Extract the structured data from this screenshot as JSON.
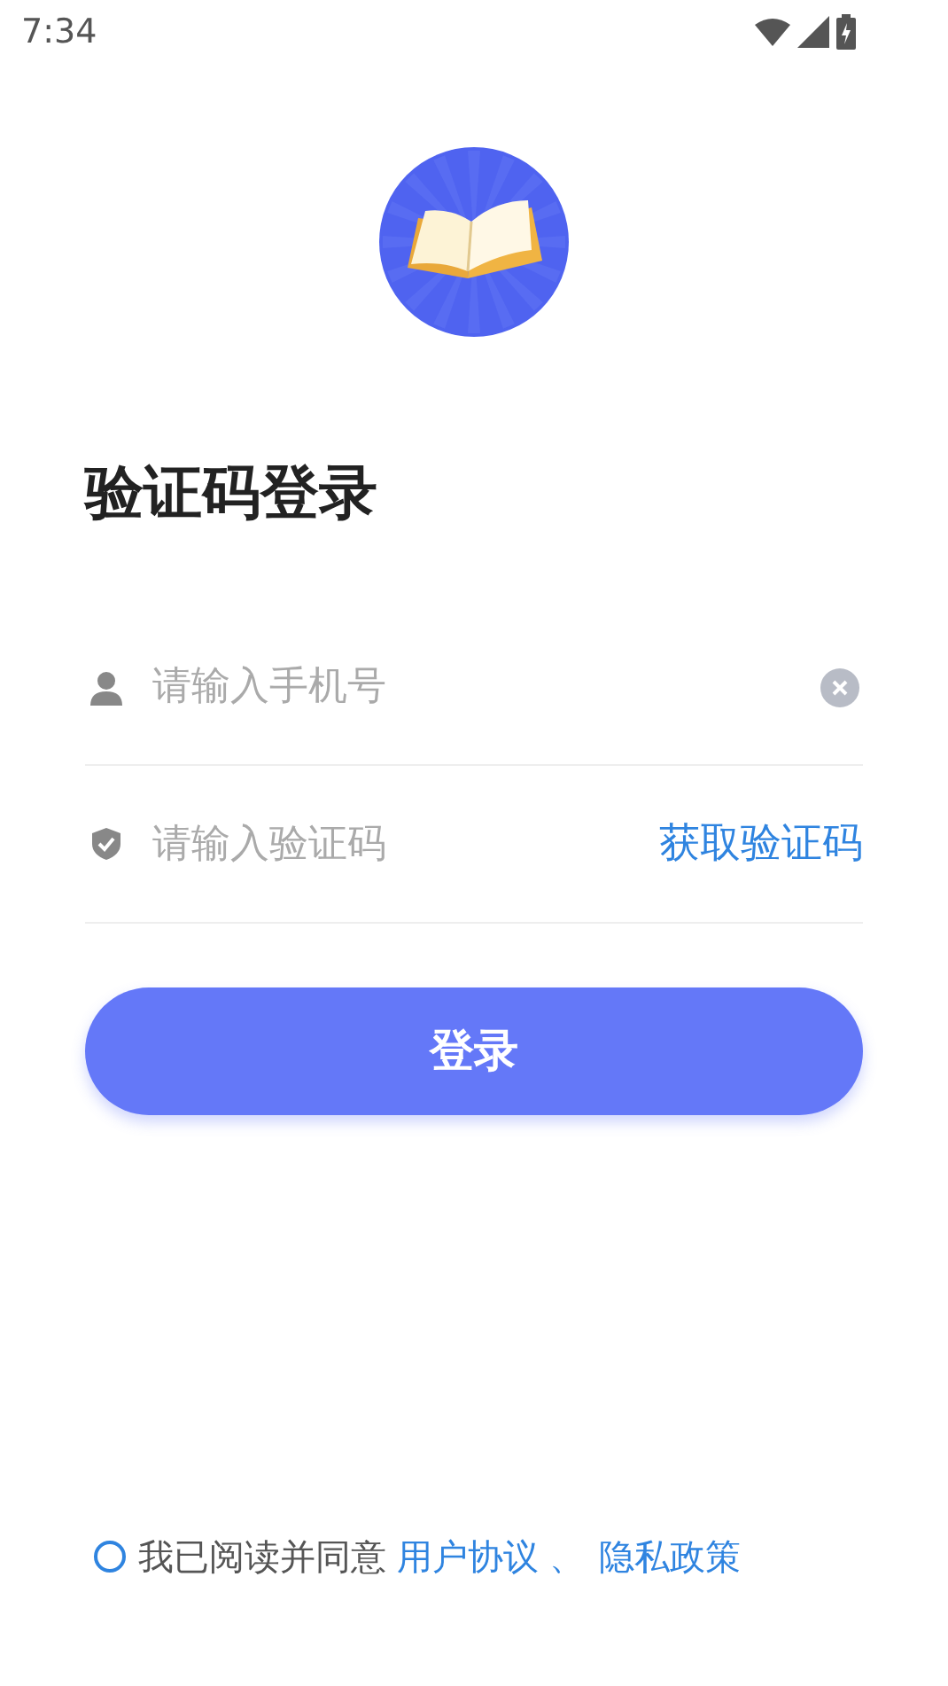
{
  "status_bar": {
    "time": "7:34"
  },
  "title": "验证码登录",
  "phone_field": {
    "placeholder": "请输入手机号"
  },
  "code_field": {
    "placeholder": "请输入验证码",
    "action": "获取验证码"
  },
  "login_button": "登录",
  "agreement": {
    "checked": false,
    "text": "我已阅读并同意",
    "links": [
      "用户协议",
      "隐私政策"
    ],
    "separator": "、"
  }
}
